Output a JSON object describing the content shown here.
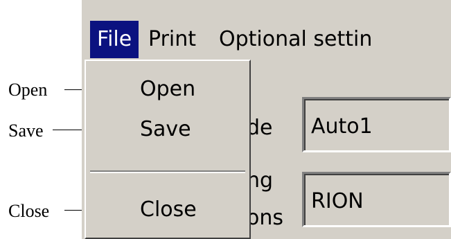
{
  "callouts": {
    "open": "Open",
    "save": "Save",
    "close": "Close"
  },
  "menubar": {
    "file": "File",
    "print": "Print",
    "optional": "Optional settin"
  },
  "file_menu": {
    "open": "Open",
    "save": "Save",
    "close": "Close"
  },
  "form": {
    "label1_partial": "de",
    "value1": "Auto1",
    "label2_partial_top": "ng",
    "label2_partial_bottom": "ons",
    "value2": "RION"
  },
  "colors": {
    "menu_highlight": "#0b1280",
    "face": "#d4d0c8"
  }
}
